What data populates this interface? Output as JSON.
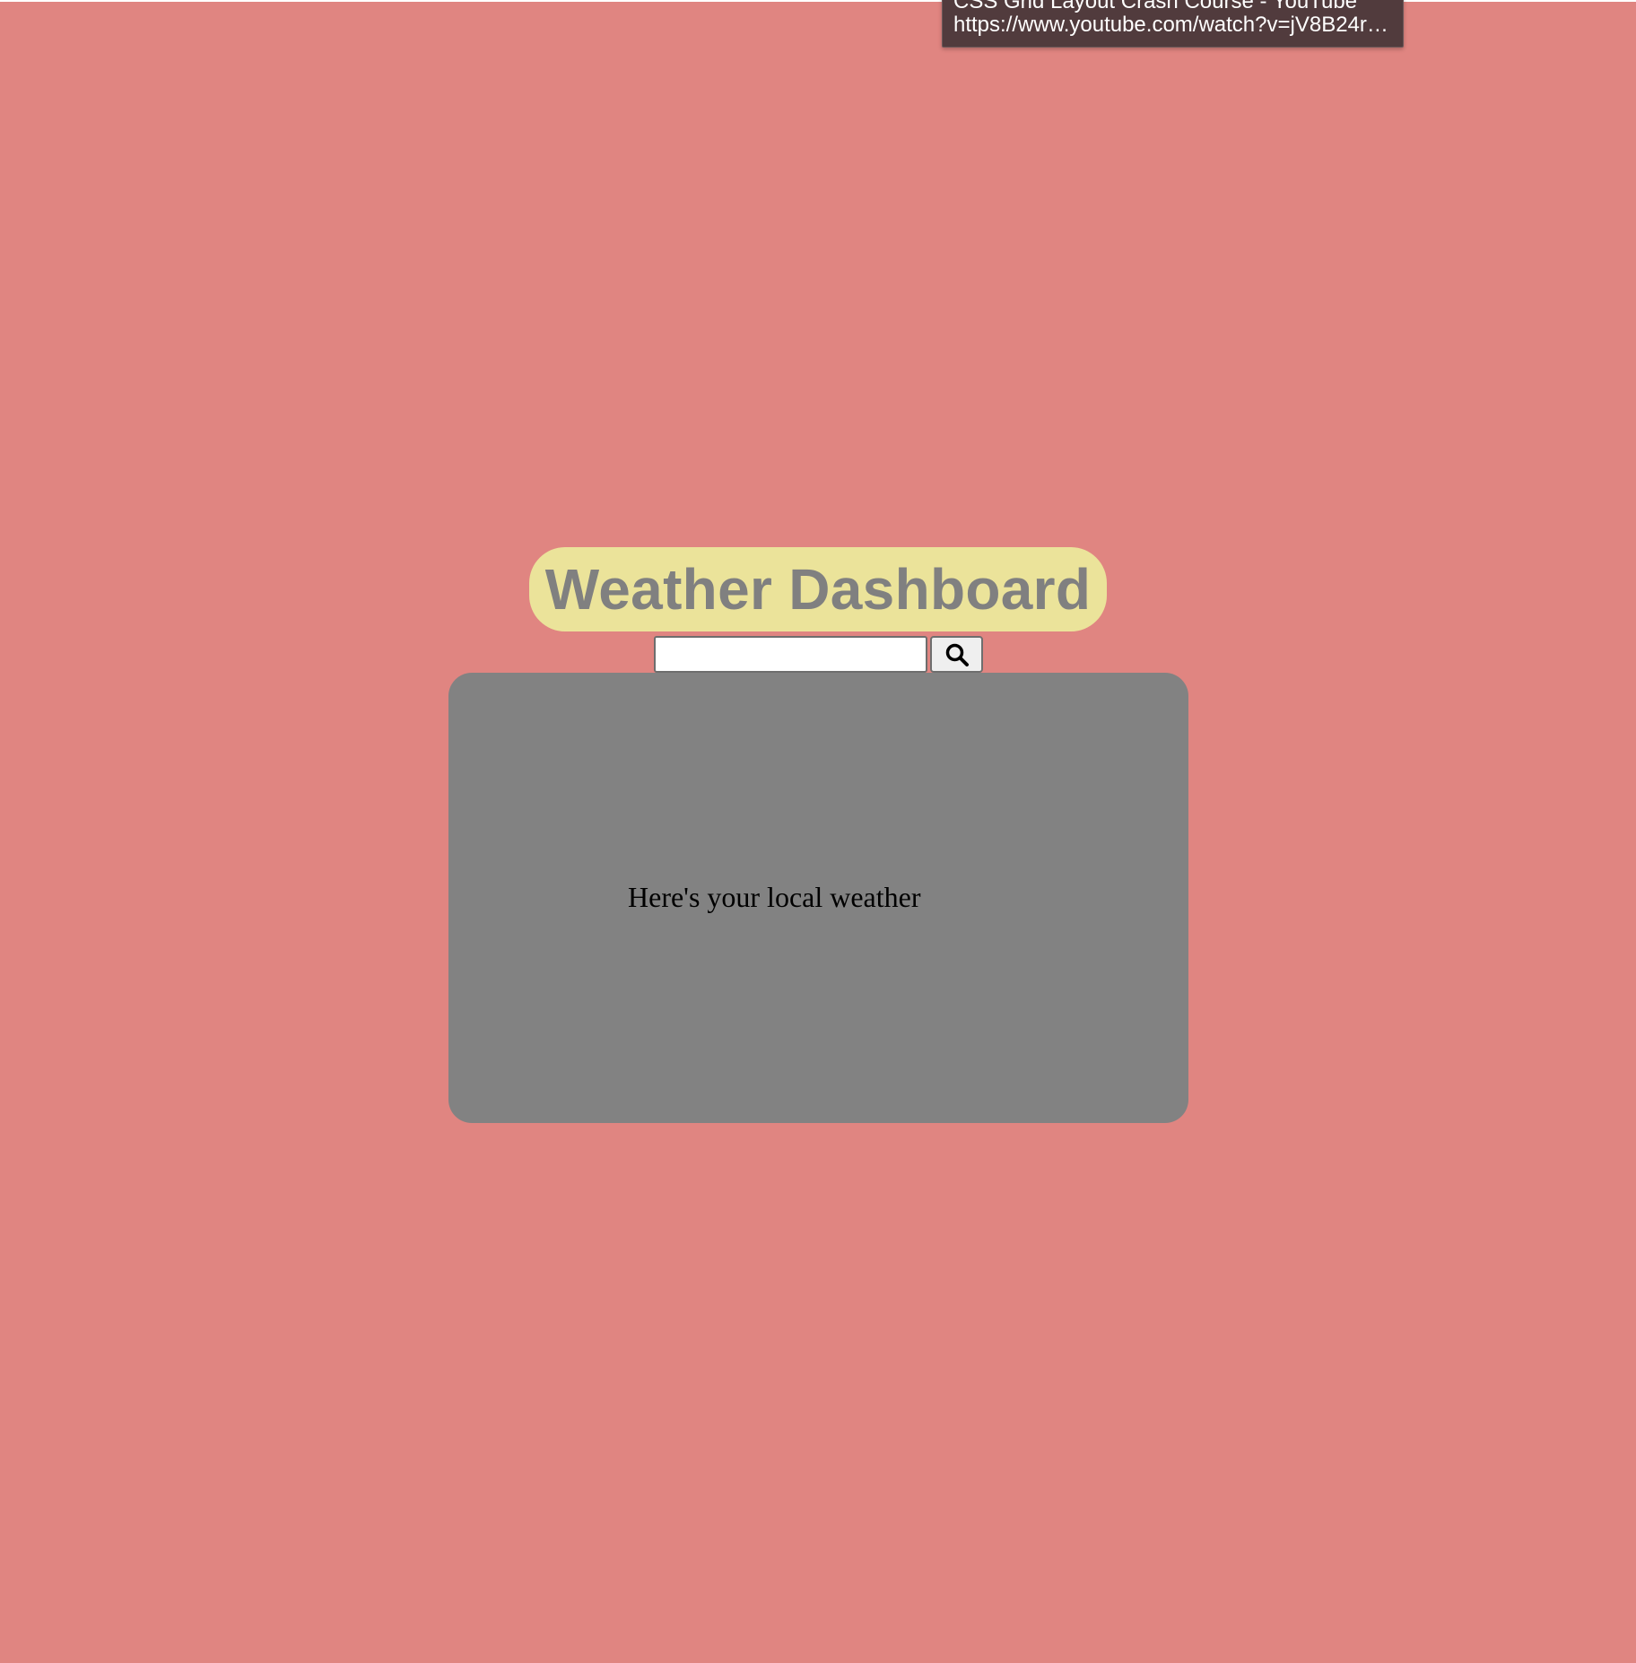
{
  "tooltip": {
    "title": "CSS Grid Layout Crash Course - YouTube",
    "url": "https://www.youtube.com/watch?v=jV8B24rS..."
  },
  "header": {
    "title": "Weather Dashboard"
  },
  "search": {
    "value": "",
    "button_icon": "search-icon"
  },
  "weather_card": {
    "text": "Here's your local weather"
  },
  "colors": {
    "page_background": "#e08581",
    "title_background": "#ebe39a",
    "title_text": "#808080",
    "card_background": "#828282",
    "tooltip_background": "#513b3d"
  }
}
